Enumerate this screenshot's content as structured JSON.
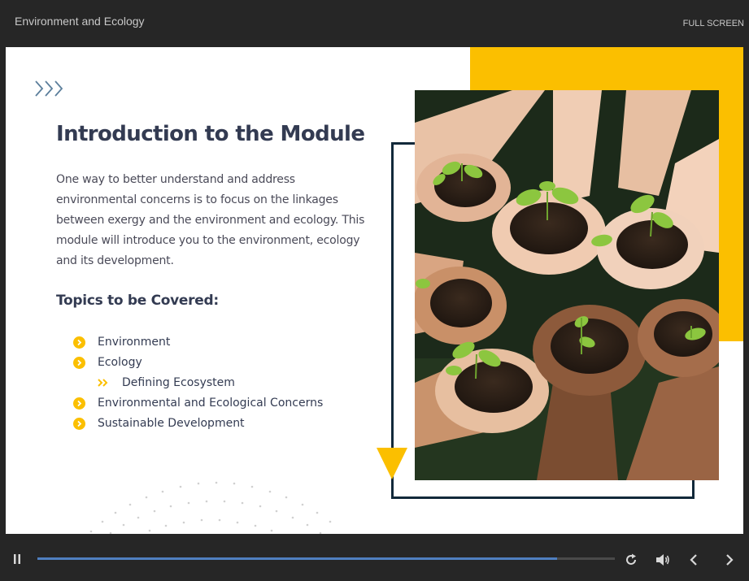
{
  "header": {
    "course_title": "Environment and Ecology",
    "fullscreen_label": "FULL SCREEN"
  },
  "slide": {
    "title": "Introduction to the Module",
    "intro_lines": [
      "One way to better understand and address",
      "environmental concerns is to focus on the linkages",
      "between exergy and the environment and ecology. This",
      "module will introduce you to the environment, ecology",
      "and its development."
    ],
    "topics_heading": "Topics to be Covered:",
    "topics": [
      {
        "label": "Environment",
        "level": 1
      },
      {
        "label": "Ecology",
        "level": 1
      },
      {
        "label": "Defining Ecosystem",
        "level": 2
      },
      {
        "label": "Environmental and Ecological Concerns",
        "level": 1
      },
      {
        "label": "Sustainable Development",
        "level": 1
      }
    ]
  },
  "player": {
    "progress": 0.9,
    "icons": [
      "pause-icon",
      "replay-icon",
      "volume-icon",
      "previous-icon",
      "next-icon"
    ]
  },
  "colors": {
    "accent": "#fbbf00",
    "dark_navy": "#12293a",
    "heading": "#333b52",
    "progress": "#4f7fc0"
  }
}
